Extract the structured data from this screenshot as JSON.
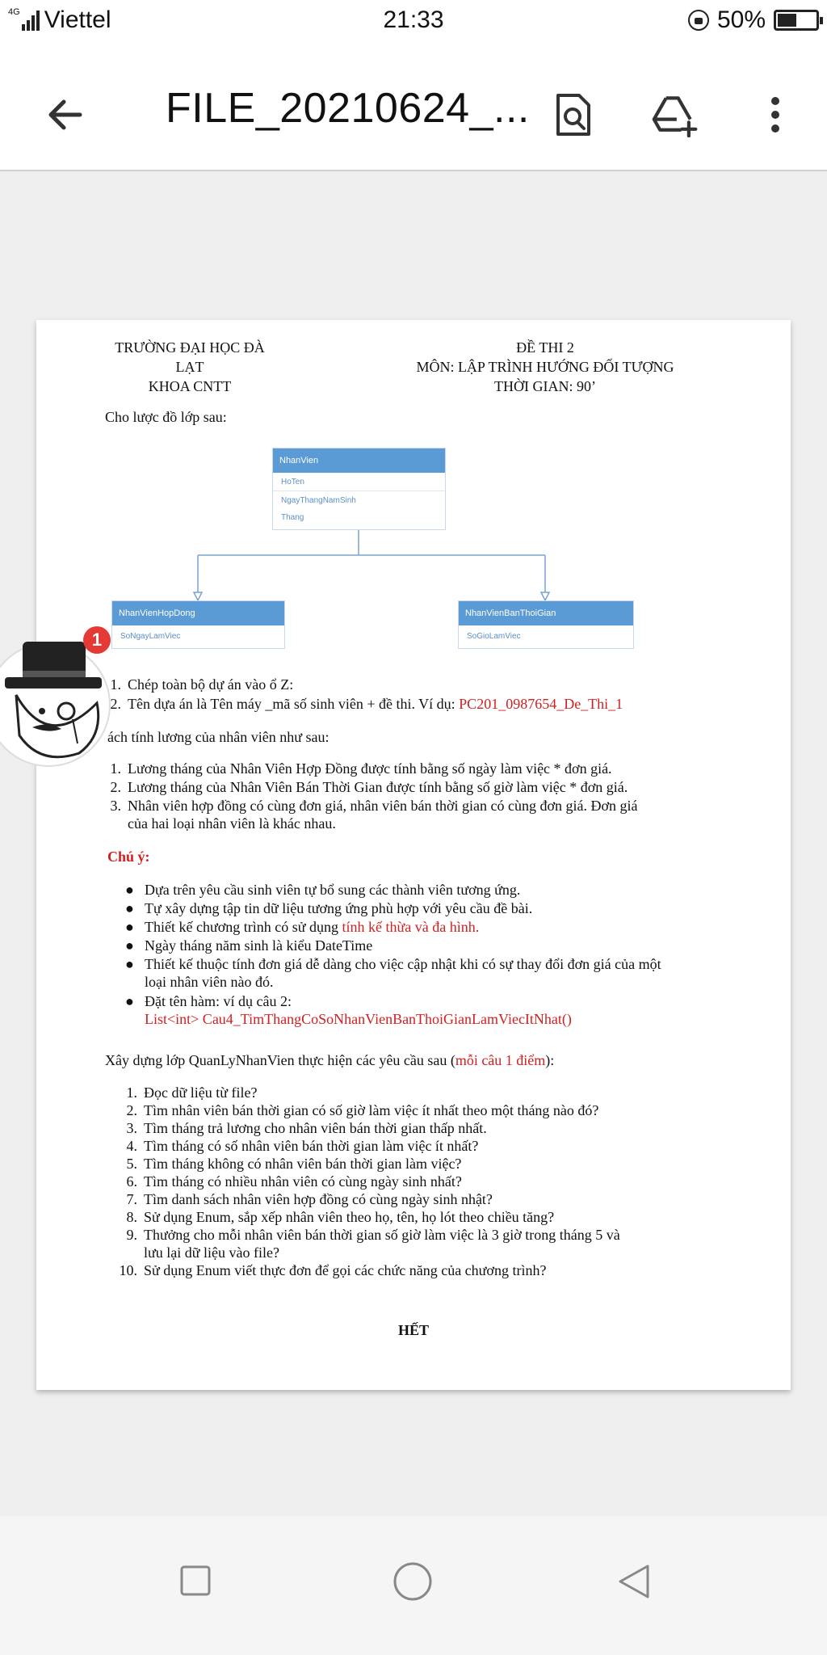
{
  "status_bar": {
    "network": "4G",
    "carrier": "Viettel",
    "time": "21:33",
    "battery": "50%",
    "battery_level": 0.5
  },
  "app_bar": {
    "title": "FILE_20210624_...",
    "icons": [
      "back-arrow-icon",
      "search-document-icon",
      "add-to-drive-icon",
      "more-vert-icon"
    ]
  },
  "document": {
    "header_left": [
      "TRƯỜNG ĐẠI HỌC ĐÀ LẠT",
      "KHOA CNTT"
    ],
    "header_right": [
      "ĐỀ THI 2",
      "MÔN: LẬP TRÌNH HƯỚNG ĐỐI TƯỢNG",
      "THỜI GIAN: 90’"
    ],
    "intro": "Cho lược đồ lớp sau:",
    "uml": {
      "parent": {
        "name": "NhanVien",
        "attrs": [
          "HoTen",
          "NgayThangNamSinh",
          "Thang"
        ]
      },
      "child_left": {
        "name": "NhanVienHopDong",
        "attrs": [
          "SoNgayLamViec"
        ]
      },
      "child_right": {
        "name": "NhanVienBanThoiGian",
        "attrs": [
          "SoGioLamViec"
        ]
      },
      "colors": {
        "header": "#5b9bd5",
        "attr_text": "#5b8fc7",
        "line": "#7aa3d0"
      }
    },
    "setup_items": [
      {
        "num": "1.",
        "text": "Chép toàn bộ dự án vào ổ Z:"
      },
      {
        "num": "2.",
        "text": "Tên dựa án là Tên máy _mã số sinh viên + đề thi. Ví dụ: ",
        "red": "PC201_0987654_De_Thi_1"
      }
    ],
    "salary_intro": "ách tính lương của nhân viên như sau:",
    "salary_items": [
      {
        "num": "1.",
        "text": "Lương tháng của Nhân Viên Hợp Đồng được tính bằng số ngày làm việc * đơn giá."
      },
      {
        "num": "2.",
        "text": "Lương tháng của Nhân Viên Bán Thời Gian được tính bằng số giờ làm việc * đơn giá."
      },
      {
        "num": "3.",
        "line1": "Nhân viên hợp đồng có cùng đơn giá, nhân viên bán thời gian có cùng đơn giá. Đơn giá",
        "line2": "của hai loại nhân viên là khác nhau."
      }
    ],
    "note_title": "Chú ý:",
    "notes": [
      {
        "text": "Dựa trên yêu cầu sinh viên tự bổ sung các thành viên tương ứng."
      },
      {
        "text": "Tự xây dựng tập tin dữ liệu tương ứng phù hợp với yêu cầu đề bài."
      },
      {
        "text": "Thiết kế chương trình có sử dụng ",
        "red": "tính kế thừa và đa hình."
      },
      {
        "text": "Ngày tháng năm sinh là kiểu DateTime"
      },
      {
        "line1": "Thiết kế thuộc tính đơn giá dễ dàng cho việc cập nhật khi có sự thay đổi đơn giá của một",
        "line2": "loại nhân viên nào đó."
      },
      {
        "line1": "Đặt tên hàm: ví dụ câu 2:",
        "red_line2": "List<int> Cau4_TimThangCoSoNhanVienBanThoiGianLamViecItNhat()"
      }
    ],
    "task_intro": "Xây dựng lớp QuanLyNhanVien thực hiện các yêu cầu sau (",
    "task_intro_red": "mỗi câu 1 điểm",
    "task_intro_end": "):",
    "tasks": [
      {
        "num": "1.",
        "text": "Đọc dữ liệu từ file?"
      },
      {
        "num": "2.",
        "text": "Tìm nhân viên bán thời gian có số giờ làm việc ít nhất theo một tháng nào đó?"
      },
      {
        "num": "3.",
        "text": "Tìm tháng trả lương cho nhân viên bán thời gian thấp nhất."
      },
      {
        "num": "4.",
        "text": "Tìm tháng có số nhân viên bán thời gian làm việc ít nhất?"
      },
      {
        "num": "5.",
        "text": "Tìm tháng không có nhân viên bán thời gian làm việc?"
      },
      {
        "num": "6.",
        "text": "Tìm tháng có nhiều nhân viên có cùng ngày sinh nhất?"
      },
      {
        "num": "7.",
        "text": "Tìm danh sách nhân viên hợp đồng có cùng ngày sinh nhật?"
      },
      {
        "num": "8.",
        "text": "Sử dụng Enum, sắp xếp nhân viên theo họ, tên, họ lót theo chiều tăng?"
      },
      {
        "num": "9.",
        "line1": "Thưởng cho mỗi nhân viên bán thời gian số giờ làm việc là 3 giờ trong tháng 5 và",
        "line2": "lưu lại dữ liệu vào file?"
      },
      {
        "num": "10.",
        "text": "Sử dụng Enum viết thực đơn để gọi các chức năng của chương trình?"
      }
    ],
    "end": "HẾT"
  },
  "chat_head": {
    "badge": "1"
  },
  "nav_bar": {
    "buttons": [
      "recents-square-icon",
      "home-circle-icon",
      "back-triangle-icon"
    ]
  }
}
